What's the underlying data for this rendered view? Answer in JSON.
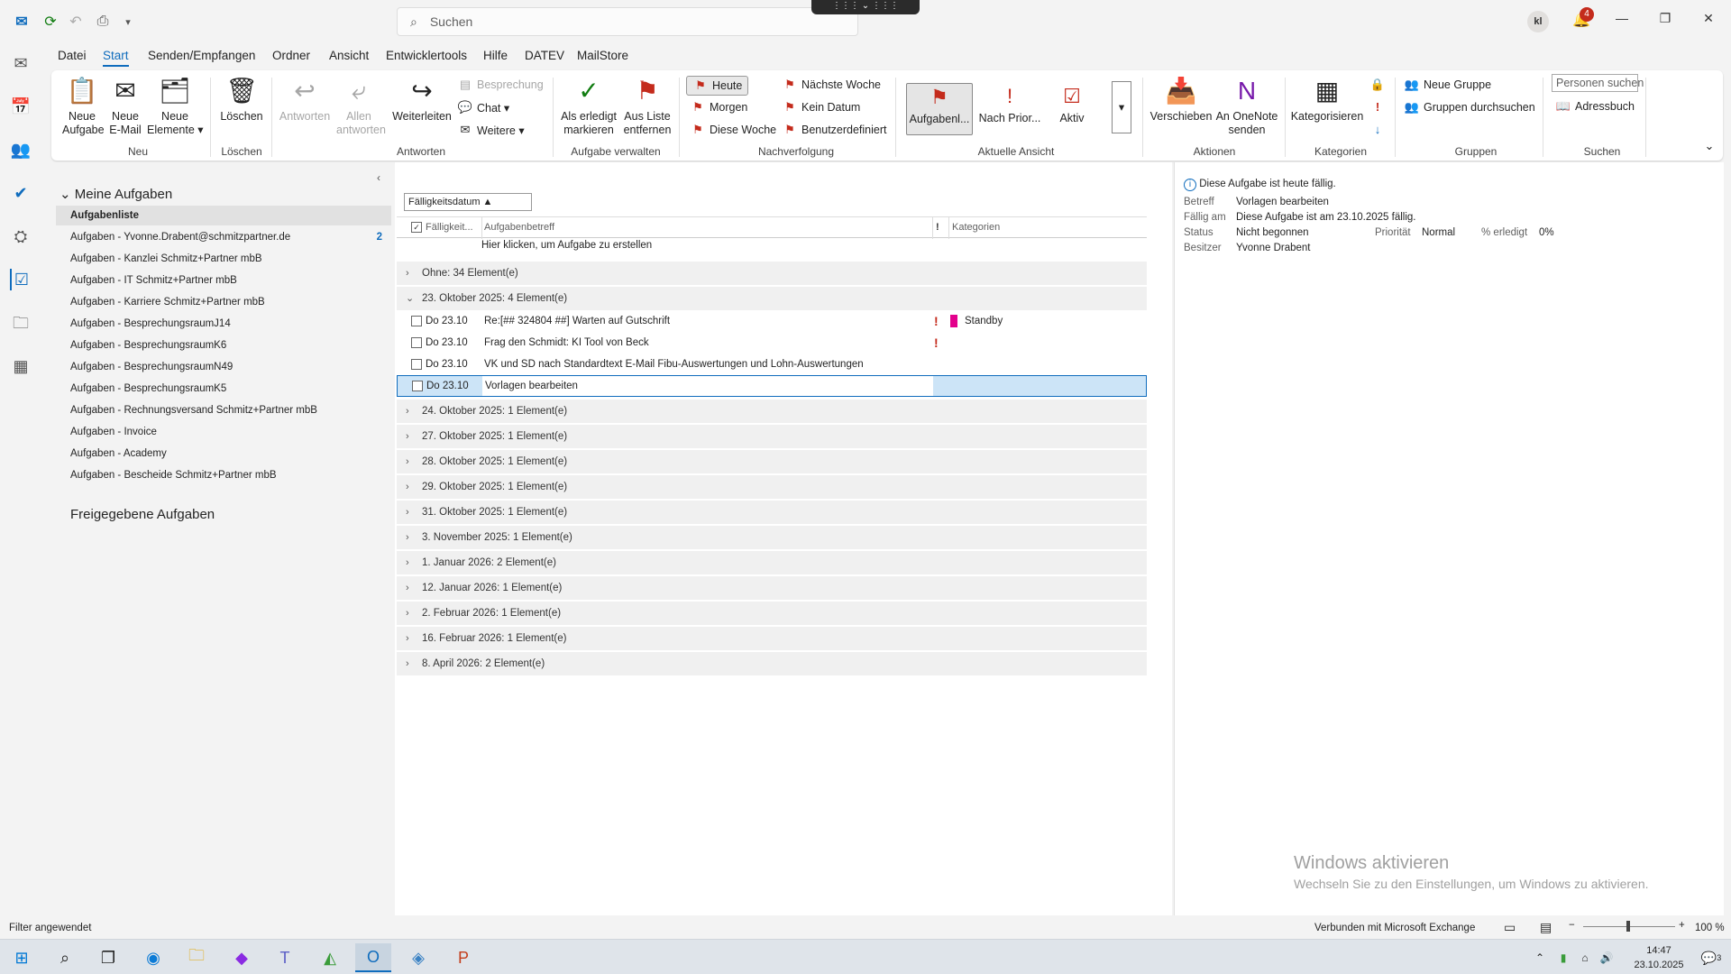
{
  "titlebar": {
    "search_placeholder": "Suchen",
    "avatar_initials": "kl",
    "notification_count": "4"
  },
  "menubar": [
    "Datei",
    "Start",
    "Senden/Empfangen",
    "Ordner",
    "Ansicht",
    "Entwicklertools",
    "Hilfe",
    "DATEV",
    "MailStore"
  ],
  "ribbon": {
    "neue_aufgabe": "Neue\nAufgabe",
    "neue_email": "Neue\nE-Mail",
    "neue_elemente": "Neue\nElemente ▾",
    "loeschen": "Löschen",
    "antworten": "Antworten",
    "allen_antworten": "Allen\nantworten",
    "weiterleiten": "Weiterleiten",
    "besprechung": "Besprechung",
    "chat": "Chat ▾",
    "weitere": "Weitere ▾",
    "als_erledigt": "Als erledigt\nmarkieren",
    "aus_liste": "Aus Liste\nentfernen",
    "heute": "Heute",
    "morgen": "Morgen",
    "diese_woche": "Diese Woche",
    "naechste_woche": "Nächste Woche",
    "kein_datum": "Kein Datum",
    "benutzerdefiniert": "Benutzerdefiniert",
    "view1": "Aufgabenl...",
    "view2": "Nach Prior...",
    "view3": "Aktiv",
    "verschieben": "Verschieben",
    "onenote": "An OneNote\nsenden",
    "kategorisieren": "Kategorisieren",
    "neue_gruppe": "Neue Gruppe",
    "gruppen_durchsuchen": "Gruppen durchsuchen",
    "personen_suchen": "Personen suchen",
    "adressbuch": "Adressbuch",
    "groups": [
      "Neu",
      "Löschen",
      "Antworten",
      "Aufgabe verwalten",
      "Nachverfolgung",
      "Aktuelle Ansicht",
      "Aktionen",
      "Kategorien",
      "Gruppen",
      "Suchen"
    ]
  },
  "nav": {
    "meine_aufgaben": "Meine Aufgaben",
    "items": [
      {
        "label": "Aufgabenliste",
        "count": ""
      },
      {
        "label": "Aufgaben - Yvonne.Drabent@schmitzpartner.de",
        "count": "2"
      },
      {
        "label": "Aufgaben - Kanzlei Schmitz+Partner mbB",
        "count": ""
      },
      {
        "label": "Aufgaben - IT Schmitz+Partner mbB",
        "count": ""
      },
      {
        "label": "Aufgaben - Karriere Schmitz+Partner mbB",
        "count": ""
      },
      {
        "label": "Aufgaben - BesprechungsraumJ14",
        "count": ""
      },
      {
        "label": "Aufgaben - BesprechungsraumK6",
        "count": ""
      },
      {
        "label": "Aufgaben - BesprechungsraumN49",
        "count": ""
      },
      {
        "label": "Aufgaben - BesprechungsraumK5",
        "count": ""
      },
      {
        "label": "Aufgaben - Rechnungsversand Schmitz+Partner mbB",
        "count": ""
      },
      {
        "label": "Aufgaben - Invoice",
        "count": ""
      },
      {
        "label": "Aufgaben - Academy",
        "count": ""
      },
      {
        "label": "Aufgaben - Bescheide Schmitz+Partner mbB",
        "count": ""
      }
    ],
    "freigegebene": "Freigegebene Aufgaben"
  },
  "list": {
    "sort_by": "Fälligkeitsdatum",
    "col_due": "Fälligkeit...",
    "col_subject": "Aufgabenbetreff",
    "col_importance": "!",
    "col_categories": "Kategorien",
    "new_task_hint": "Hier klicken, um Aufgabe zu erstellen",
    "group_none": "Ohne: 34 Element(e)",
    "group_open": "23. Oktober 2025: 4 Element(e)",
    "tasks": [
      {
        "date": "Do 23.10",
        "subject": "Re:[## 324804 ##] Warten auf Gutschrift",
        "importance": "!",
        "category": "Standby"
      },
      {
        "date": "Do 23.10",
        "subject": "Frag den Schmidt: KI Tool von Beck",
        "importance": "!",
        "category": ""
      },
      {
        "date": "Do 23.10",
        "subject": "VK und SD nach Standardtext E-Mail Fibu-Auswertungen und Lohn-Auswertungen",
        "importance": "",
        "category": ""
      },
      {
        "date": "Do 23.10",
        "subject": "Vorlagen bearbeiten",
        "importance": "",
        "category": ""
      }
    ],
    "groups_after": [
      "24. Oktober 2025: 1 Element(e)",
      "27. Oktober 2025: 1 Element(e)",
      "28. Oktober 2025: 1 Element(e)",
      "29. Oktober 2025: 1 Element(e)",
      "31. Oktober 2025: 1 Element(e)",
      "3. November 2025: 1 Element(e)",
      "1. Januar 2026: 2 Element(e)",
      "12. Januar 2026: 1 Element(e)",
      "2. Februar 2026: 1 Element(e)",
      "16. Februar 2026: 1 Element(e)",
      "8. April 2026: 2 Element(e)"
    ]
  },
  "reading": {
    "info": "Diese Aufgabe ist heute fällig.",
    "betreff_label": "Betreff",
    "betreff": "Vorlagen bearbeiten",
    "faellig_label": "Fällig am",
    "faellig": "Diese Aufgabe ist am 23.10.2025 fällig.",
    "status_label": "Status",
    "status": "Nicht begonnen",
    "prio_label": "Priorität",
    "prio": "Normal",
    "erledigt_label": "% erledigt",
    "erledigt": "0%",
    "besitzer_label": "Besitzer",
    "besitzer": "Yvonne Drabent",
    "watermark_title": "Windows aktivieren",
    "watermark_sub": "Wechseln Sie zu den Einstellungen, um Windows zu aktivieren."
  },
  "status": {
    "filter": "Filter angewendet",
    "connection": "Verbunden mit Microsoft Exchange",
    "zoom": "100 %"
  },
  "taskbar": {
    "time": "14:47",
    "date": "23.10.2025",
    "notif": "3"
  }
}
